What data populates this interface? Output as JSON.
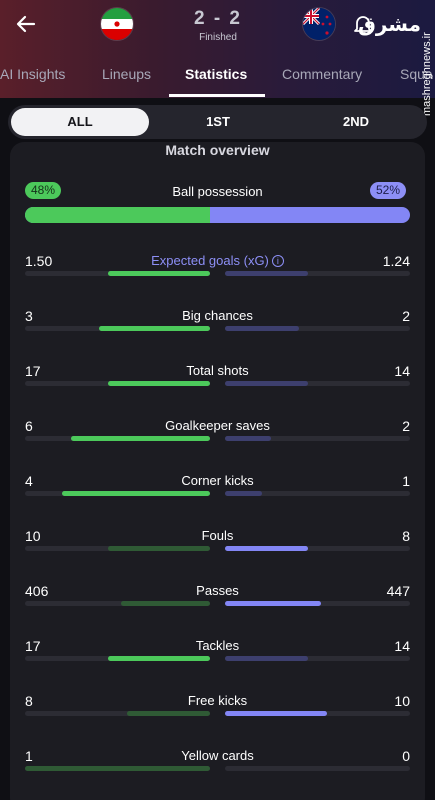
{
  "header": {
    "score": "2 - 2",
    "status": "Finished",
    "home_flag_icon": "iran-flag-icon",
    "away_flag_icon": "new-zealand-flag-icon",
    "watermark": "مشرق",
    "watermark_vertical": "mashreghnews.ir"
  },
  "tabs": [
    {
      "label": "AI Insights"
    },
    {
      "label": "Lineups"
    },
    {
      "label": "Statistics"
    },
    {
      "label": "Commentary"
    },
    {
      "label": "Squa"
    }
  ],
  "periods": [
    {
      "label": "ALL"
    },
    {
      "label": "1ST"
    },
    {
      "label": "2ND"
    }
  ],
  "overview": {
    "title": "Match overview",
    "possession": {
      "label": "Ball possession",
      "home": "48%",
      "away": "52%",
      "home_value": 48,
      "away_value": 52
    }
  },
  "stats": [
    {
      "label": "Expected goals (xG)",
      "home": "1.50",
      "away": "1.24",
      "home_fill": 0.55,
      "away_fill": 0.45,
      "home_lead": true,
      "away_lead": false
    },
    {
      "label": "Big chances",
      "home": "3",
      "away": "2",
      "home_fill": 0.6,
      "away_fill": 0.4,
      "home_lead": true,
      "away_lead": false
    },
    {
      "label": "Total shots",
      "home": "17",
      "away": "14",
      "home_fill": 0.55,
      "away_fill": 0.45,
      "home_lead": true,
      "away_lead": false
    },
    {
      "label": "Goalkeeper saves",
      "home": "6",
      "away": "2",
      "home_fill": 0.75,
      "away_fill": 0.25,
      "home_lead": true,
      "away_lead": false
    },
    {
      "label": "Corner kicks",
      "home": "4",
      "away": "1",
      "home_fill": 0.8,
      "away_fill": 0.2,
      "home_lead": true,
      "away_lead": false
    },
    {
      "label": "Fouls",
      "home": "10",
      "away": "8",
      "home_fill": 0.55,
      "away_fill": 0.45,
      "home_lead": false,
      "away_lead": true
    },
    {
      "label": "Passes",
      "home": "406",
      "away": "447",
      "home_fill": 0.48,
      "away_fill": 0.52,
      "home_lead": false,
      "away_lead": true
    },
    {
      "label": "Tackles",
      "home": "17",
      "away": "14",
      "home_fill": 0.55,
      "away_fill": 0.45,
      "home_lead": true,
      "away_lead": false
    },
    {
      "label": "Free kicks",
      "home": "8",
      "away": "10",
      "home_fill": 0.45,
      "away_fill": 0.55,
      "home_lead": false,
      "away_lead": true
    },
    {
      "label": "Yellow cards",
      "home": "1",
      "away": "0",
      "home_fill": 1.0,
      "away_fill": 0.0,
      "home_lead": false,
      "away_lead": false
    }
  ],
  "colors": {
    "home_strong": "#4cc95b",
    "home_weak": "#2f5a35",
    "away_strong": "#8386f5",
    "away_weak": "#3d3f6e",
    "accent": "#8d8ff6"
  }
}
